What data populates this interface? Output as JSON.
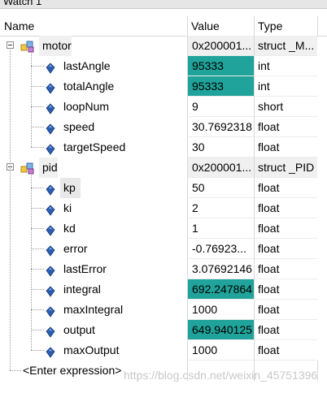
{
  "window": {
    "title": "Watch 1"
  },
  "columns": {
    "name": "Name",
    "value": "Value",
    "type": "Type"
  },
  "groups": [
    {
      "name": "motor",
      "value": "0x200001...",
      "type": "struct _M...",
      "children": [
        {
          "name": "lastAngle",
          "value": "95333",
          "type": "int",
          "highlight": true
        },
        {
          "name": "totalAngle",
          "value": "95333",
          "type": "int",
          "highlight": true
        },
        {
          "name": "loopNum",
          "value": "9",
          "type": "short",
          "highlight": false
        },
        {
          "name": "speed",
          "value": "30.7692318",
          "type": "float",
          "highlight": false
        },
        {
          "name": "targetSpeed",
          "value": "30",
          "type": "float",
          "highlight": false
        }
      ]
    },
    {
      "name": "pid",
      "value": "0x200001...",
      "type": "struct _PID",
      "children": [
        {
          "name": "kp",
          "value": "50",
          "type": "float",
          "highlight": false,
          "selected": true
        },
        {
          "name": "ki",
          "value": "2",
          "type": "float",
          "highlight": false
        },
        {
          "name": "kd",
          "value": "1",
          "type": "float",
          "highlight": false
        },
        {
          "name": "error",
          "value": "-0.76923...",
          "type": "float",
          "highlight": false
        },
        {
          "name": "lastError",
          "value": "3.07692146",
          "type": "float",
          "highlight": false
        },
        {
          "name": "integral",
          "value": "692.247864",
          "type": "float",
          "highlight": true
        },
        {
          "name": "maxIntegral",
          "value": "1000",
          "type": "float",
          "highlight": false
        },
        {
          "name": "output",
          "value": "649.940125",
          "type": "float",
          "highlight": true
        },
        {
          "name": "maxOutput",
          "value": "1000",
          "type": "float",
          "highlight": false
        }
      ]
    }
  ],
  "enter_expression": "<Enter expression>",
  "watermark": "https://blog.csdn.net/weixin_45751396",
  "colors": {
    "highlight": "#1fa39a",
    "group_bg": "#f0f0f0",
    "field_icon": "#2a5db0"
  }
}
